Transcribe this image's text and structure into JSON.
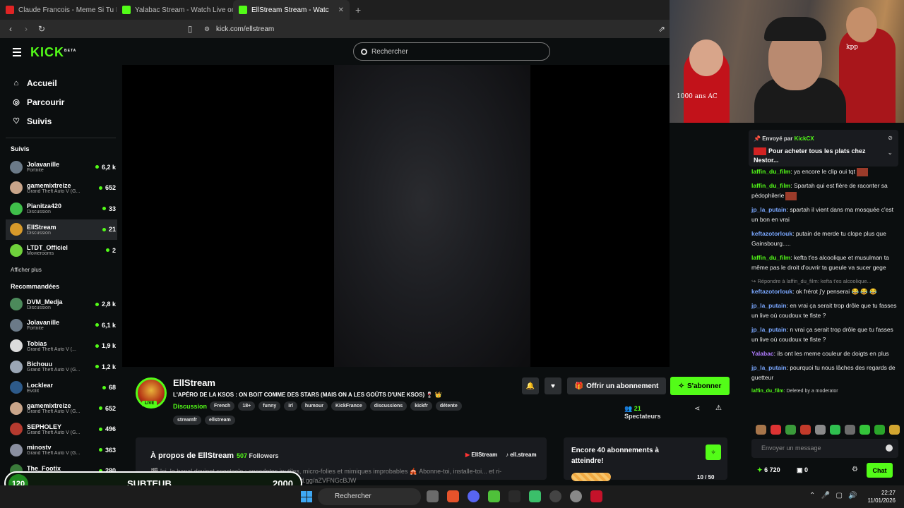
{
  "browser": {
    "tabs": [
      {
        "title": "Claude Francois - Meme Si Tu Revenais",
        "color": "#e02424"
      },
      {
        "title": "Yalabac Stream - Watch Live on Kick",
        "color": "#53fc18"
      },
      {
        "title": "EllStream Stream - Watch Live on Kick",
        "color": "#53fc18"
      }
    ],
    "url": "kick.com/ellstream"
  },
  "header": {
    "logo": "KICK",
    "logo_badge": "BETA",
    "search_placeholder": "Rechercher"
  },
  "nav": {
    "items": [
      {
        "label": "Accueil",
        "icon": "home-icon"
      },
      {
        "label": "Parcourir",
        "icon": "compass-icon"
      },
      {
        "label": "Suivis",
        "icon": "heart-icon"
      }
    ]
  },
  "following": {
    "title": "Suivis",
    "channels": [
      {
        "name": "Jolavanille",
        "category": "Fortnite",
        "viewers": "6,2 k",
        "color": "#6b7a88"
      },
      {
        "name": "gamemixtreize",
        "category": "Grand Theft Auto V (G...",
        "viewers": "652",
        "color": "#c9a58a"
      },
      {
        "name": "Pianitza420",
        "category": "Discussion",
        "viewers": "33",
        "color": "#3fbf4a"
      },
      {
        "name": "EllStream",
        "category": "Discussion",
        "viewers": "21",
        "color": "#d89a2a"
      },
      {
        "name": "LTDT_Officiel",
        "category": "Movierooms",
        "viewers": "2",
        "color": "#6fd13b"
      }
    ],
    "more": "Afficher plus"
  },
  "recommended": {
    "title": "Recommandées",
    "channels": [
      {
        "name": "DVM_Medja",
        "category": "Discussion",
        "viewers": "2,8 k",
        "color": "#4c8a5b"
      },
      {
        "name": "Jolavanille",
        "category": "Fortnite",
        "viewers": "6,1 k",
        "color": "#6b7a88"
      },
      {
        "name": "Tobias",
        "category": "Grand Theft Auto V (...",
        "viewers": "1,9 k",
        "color": "#dcdcdc"
      },
      {
        "name": "Bichouu",
        "category": "Grand Theft Auto V (G...",
        "viewers": "1,2 k",
        "color": "#9aa6b5"
      },
      {
        "name": "Locklear",
        "category": "Evolit",
        "viewers": "68",
        "color": "#2d5a8a"
      },
      {
        "name": "gamemixtreize",
        "category": "Grand Theft Auto V (G...",
        "viewers": "652",
        "color": "#c9a58a"
      },
      {
        "name": "SEPHOLEY",
        "category": "Grand Theft Auto V (G...",
        "viewers": "496",
        "color": "#b53a2f"
      },
      {
        "name": "minostv",
        "category": "Grand Theft Auto V (G...",
        "viewers": "363",
        "color": "#8a8fa0"
      },
      {
        "name": "The_Footix",
        "category": "Grand Theft Auto V (G...",
        "viewers": "280",
        "color": "#3a7a3a"
      }
    ]
  },
  "stream": {
    "name": "EllStream",
    "live_label": "LIVE",
    "title": "L'APÉRO DE LA KSOS : ON BOIT COMME DES STARS (MAIS ON A LES GOÛTS D'UNE KSOS) 🍷 👑",
    "category": "Discussion",
    "tags": [
      "French",
      "18+",
      "funny",
      "irl",
      "humour",
      "KickFrance",
      "discussions",
      "kickfr",
      "détente"
    ],
    "tags2": [
      "streamfr",
      "ellstream"
    ],
    "gift_label": "Offrir un abonnement",
    "subscribe_label": "S'abonner",
    "viewers_count": "21",
    "viewers_label": "Spectateurs"
  },
  "about": {
    "title": "À propos de EllStream",
    "followers_count": "507",
    "followers_label": "Followers",
    "youtube": "EllStream",
    "tiktok": "ell.stream",
    "desc1": "🎬 Ici, le banal devient spectacle : anecdotes inutiles, micro-folies et mimiques improbables 🎪 Abonne-toi, installe-toi... et ri-",
    "desc2": "ensemble de tout (et surtout de rien) ✨ https://discord.gg/aZVFNGcBJW"
  },
  "goal": {
    "title": "Encore 40 abonnements à atteindre!",
    "current": 10,
    "target": 50,
    "progress_text": "10 / 50"
  },
  "webcam": {
    "text1": "1000 ans AC",
    "text2": "kpp"
  },
  "chat": {
    "pinned": {
      "sent_by": "Envoyé par",
      "sender": "KickCX",
      "message": "Pour acheter tous les plats chez Nestor..."
    },
    "messages": [
      {
        "user": "laffin_du_film",
        "text": "ya encore le clip oui tqt",
        "cls": ""
      },
      {
        "user": "laffin_du_film",
        "text": "Spartah qui est fière de raconter sa pédophilerie",
        "cls": ""
      },
      {
        "user": "jp_la_putain",
        "text": "spartah il vient dans ma mosquée c'est un bon en vrai",
        "cls": "b"
      },
      {
        "user": "keftazotorlouk",
        "text": "putain de merde tu clope plus que Gainsbourg.....",
        "cls": "b"
      },
      {
        "user": "laffin_du_film",
        "text": "kefta t'es alcoolique et musulman ta même pas le droit d'ouvrir ta gueule va sucer gege",
        "cls": ""
      },
      {
        "user": "keftazotorlouk",
        "text": "ok frérot j'y penserai 😂 😂 😂",
        "cls": "b",
        "reply": "↪ Répondre à laffin_du_film: kefta t'es alcoolique..."
      },
      {
        "user": "jp_la_putain",
        "text": "en vrai ça serait trop drôle que tu fasses un live où coudoux te fiste ?",
        "cls": "b"
      },
      {
        "user": "jp_la_putain",
        "text": "n vrai ça serait trop drôle que tu fasses un live où coudoux te fiste ?",
        "cls": "b"
      },
      {
        "user": "Yalabac",
        "text": "ils ont les meme couleur de doigts en plus",
        "cls": "p"
      },
      {
        "user": "jp_la_putain",
        "text": "pourquoi tu nous lâches des regards de guetteur",
        "cls": "b"
      },
      {
        "user": "laffin_du_film",
        "text": "Deleted by a moderator",
        "cls": "",
        "deleted": true
      }
    ],
    "input_placeholder": "Envoyer un message",
    "points": "6 720",
    "subs": "0",
    "chat_button": "Chat"
  },
  "overlay": {
    "level": "120",
    "label": "SUBTEUB",
    "value": "2000"
  },
  "taskbar": {
    "search": "Rechercher",
    "time": "22:27",
    "date": "11/01/2026"
  }
}
